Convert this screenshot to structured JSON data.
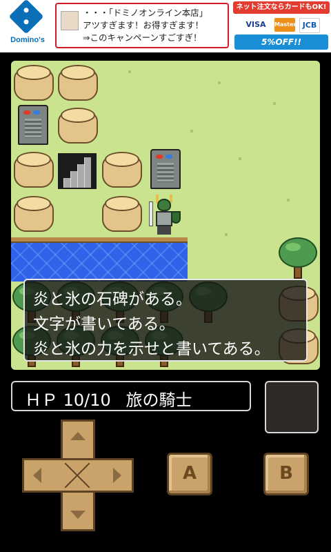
{
  "ad": {
    "brand": "Domino's",
    "lines": [
      "・・・「ドミノオンライン本店」",
      "アツすぎます！お得すぎます！",
      "⇒このキャンペーンすごすぎ！"
    ],
    "side_banner": "ネット注文ならカードもOK!",
    "cards": [
      "VISA",
      "MasterCard",
      "JCB"
    ],
    "discount": "5%OFF!!",
    "colors": {
      "brand_blue": "#0a6fb6",
      "border_red": "#d21a2a"
    }
  },
  "dialog": {
    "lines": [
      "炎と氷の石碑がある。",
      "文字が書いてある。",
      "炎と氷の力を示せと書いてある。"
    ]
  },
  "status": {
    "hp_label": "ＨＰ",
    "hp_value": "10/10",
    "title": "旅の騎士"
  },
  "controls": {
    "a_label": "A",
    "b_label": "B",
    "dpad_icons": [
      "up-arrow-icon",
      "down-arrow-icon",
      "left-arrow-icon",
      "right-arrow-icon"
    ]
  },
  "palette": {
    "grass": "#c9e38f",
    "water": "#2f62e8",
    "button": "#c9a36a",
    "button_border": "#5c4222"
  }
}
